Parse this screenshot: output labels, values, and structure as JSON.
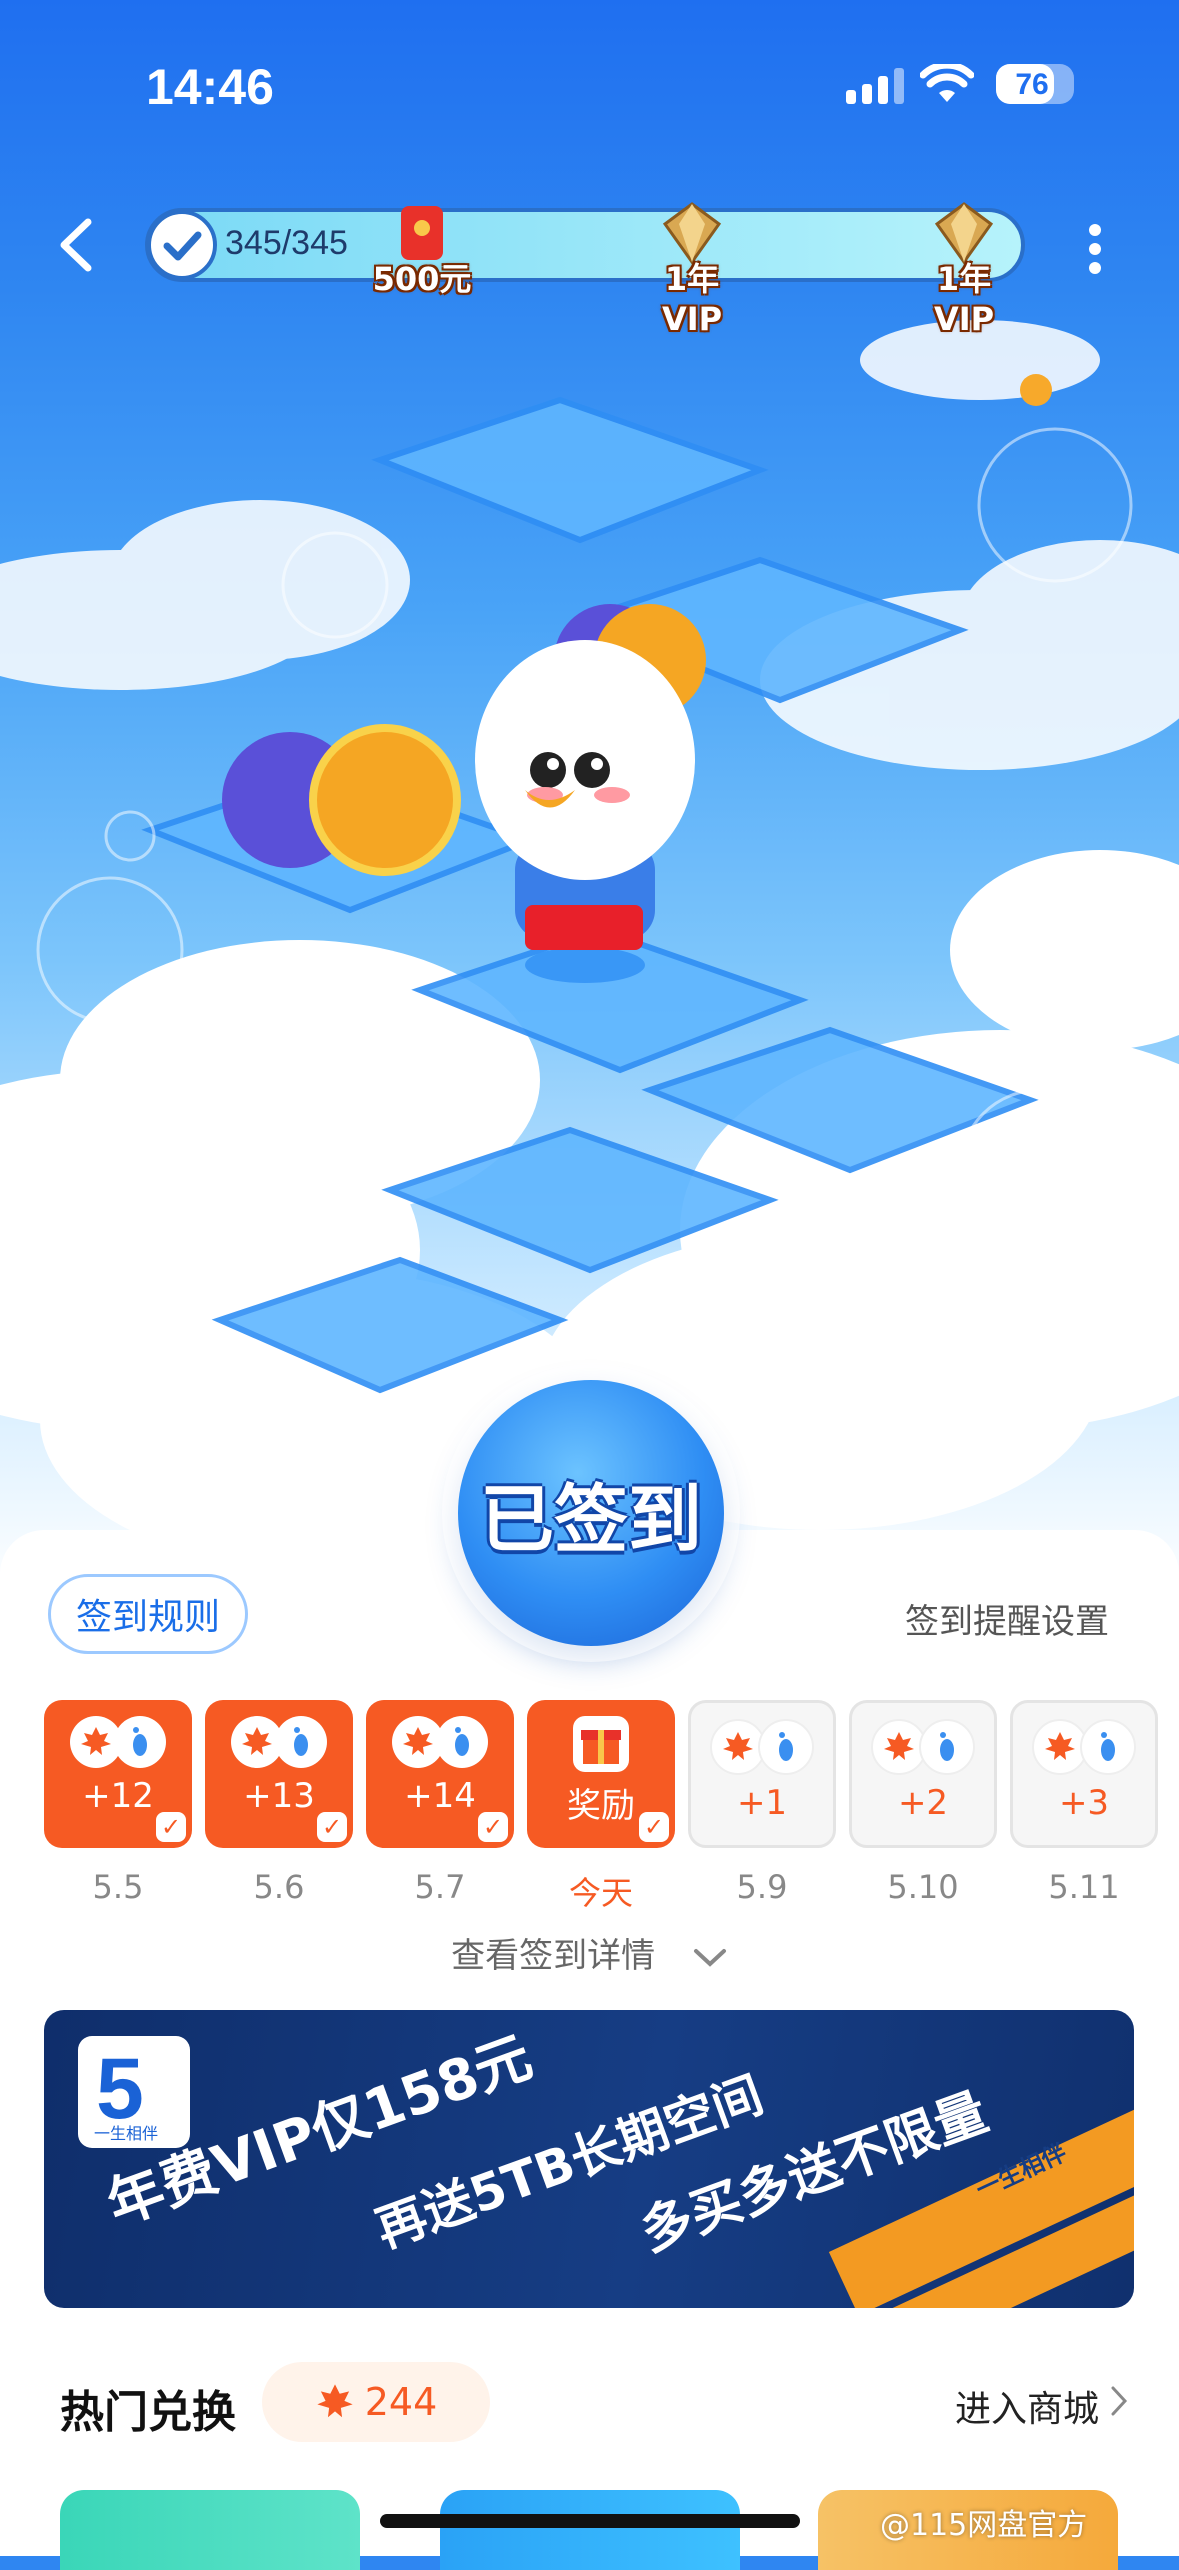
{
  "status_bar": {
    "time": "14:46",
    "battery": "76"
  },
  "progress": {
    "count": "345/345",
    "milestones": [
      {
        "label": "500元",
        "icon": "red-envelope-icon"
      },
      {
        "label": "1年VIP",
        "icon": "diamond-gem-icon"
      },
      {
        "label": "1年VIP",
        "icon": "diamond-gem-icon"
      }
    ]
  },
  "sign_button": {
    "label": "已签到"
  },
  "panel": {
    "rules_label": "签到规则",
    "remind_label": "签到提醒设置",
    "days": [
      {
        "value": "+12",
        "date": "5.5",
        "state": "done"
      },
      {
        "value": "+13",
        "date": "5.6",
        "state": "done"
      },
      {
        "value": "+14",
        "date": "5.7",
        "state": "done"
      },
      {
        "value": "奖励",
        "date": "今天",
        "state": "today"
      },
      {
        "value": "+1",
        "date": "5.9",
        "state": "future"
      },
      {
        "value": "+2",
        "date": "5.10",
        "state": "future"
      },
      {
        "value": "+3",
        "date": "5.11",
        "state": "future"
      }
    ],
    "detail_label": "查看签到详情"
  },
  "banner": {
    "logo_number": "5",
    "logo_caption": "一生相伴",
    "line1": "年费VIP仅158元",
    "line2": "再送5TB长期空间",
    "line3": "多买多送不限量",
    "stripe_text": "一生相伴"
  },
  "hot_exchange": {
    "title": "热门兑换",
    "points": "244",
    "shop_label": "进入商城"
  },
  "watermark": "@115网盘官方",
  "colors": {
    "accent_orange": "#f65a23",
    "accent_blue": "#1a6ee8",
    "banner_navy": "#163d84"
  }
}
